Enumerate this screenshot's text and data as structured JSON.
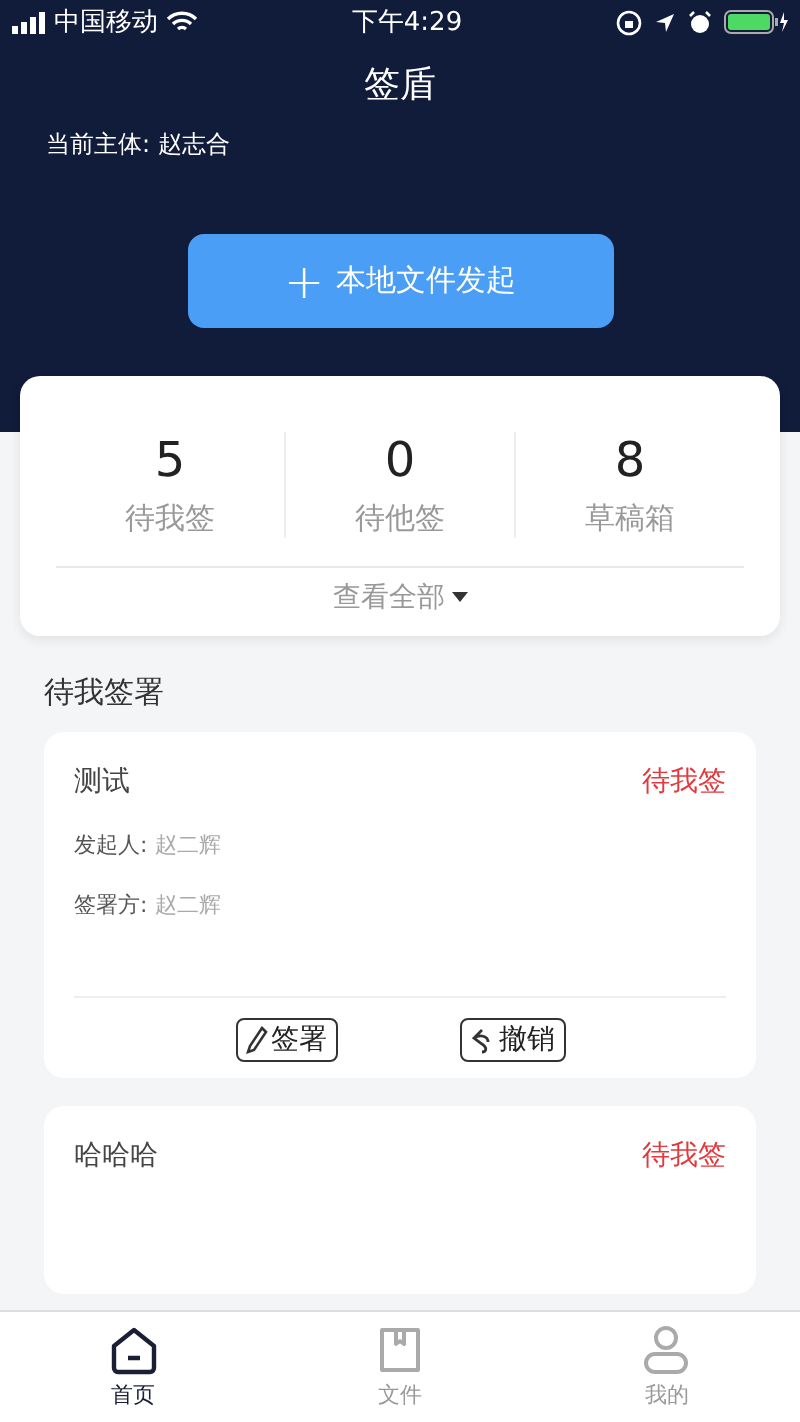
{
  "status_bar": {
    "carrier": "中国移动",
    "time": "下午4:29"
  },
  "header": {
    "title": "签盾",
    "subject_label": "当前主体:",
    "subject_name": "赵志合",
    "start_button": {
      "icon": "+",
      "label": "本地文件发起"
    }
  },
  "stats": {
    "items": [
      {
        "count": "5",
        "label": "待我签"
      },
      {
        "count": "0",
        "label": "待他签"
      },
      {
        "count": "8",
        "label": "草稿箱"
      }
    ],
    "view_all": "查看全部"
  },
  "section_title": "待我签署",
  "documents": [
    {
      "title": "测试",
      "status": "待我签",
      "fields": [
        {
          "label": "发起人:",
          "value": "赵二辉"
        },
        {
          "label": "签署方:",
          "value": "赵二辉"
        }
      ],
      "actions": [
        {
          "kind": "sign",
          "label": "签署"
        },
        {
          "kind": "revoke",
          "label": "撤销"
        }
      ]
    },
    {
      "title": "哈哈哈",
      "status": "待我签"
    }
  ],
  "tab_bar": [
    {
      "kind": "home",
      "label": "首页",
      "selected": true
    },
    {
      "kind": "files",
      "label": "文件",
      "selected": false
    },
    {
      "kind": "profile",
      "label": "我的",
      "selected": false
    }
  ]
}
